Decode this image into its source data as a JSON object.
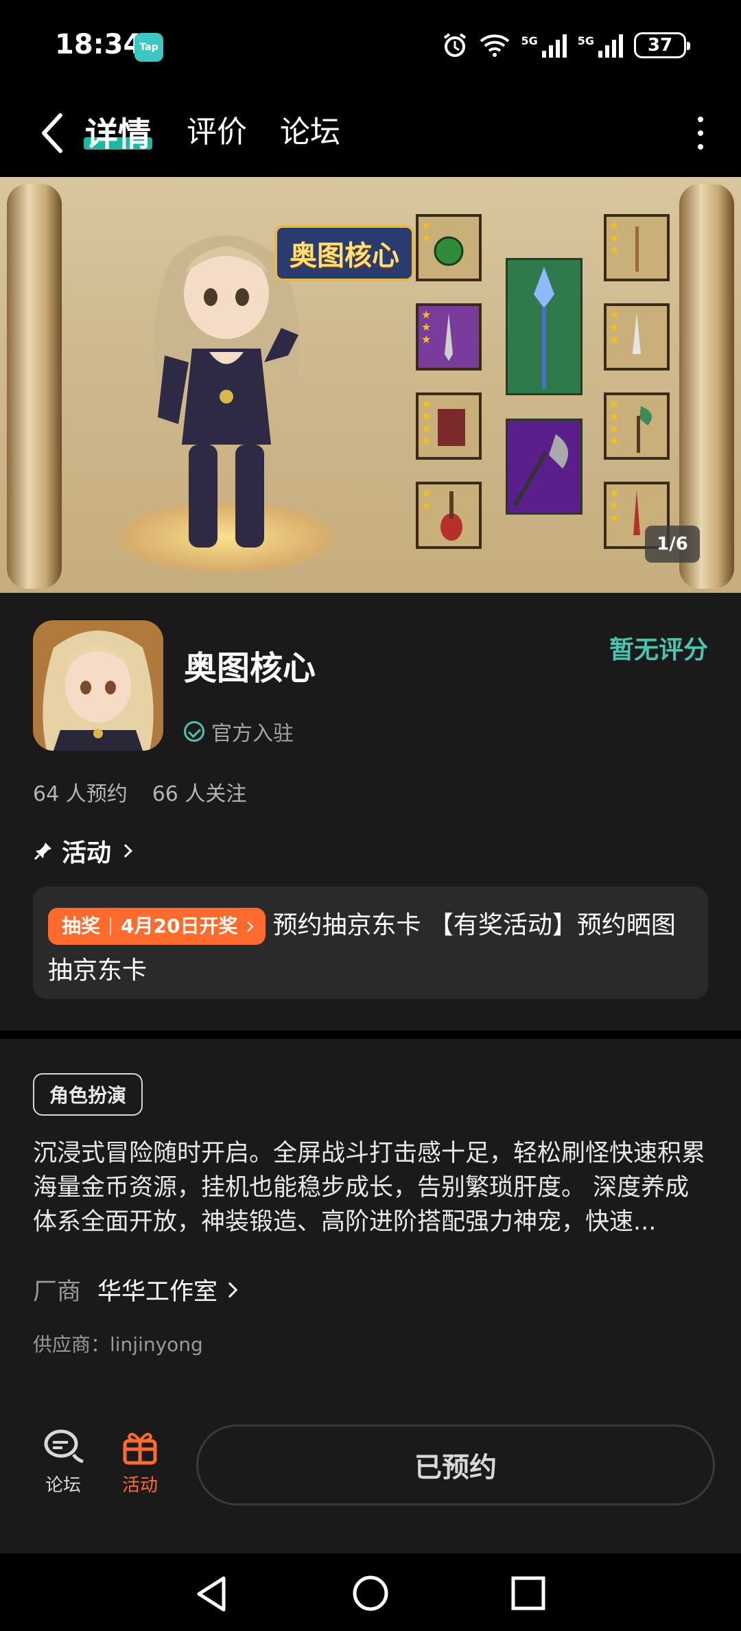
{
  "status_bar": {
    "time": "18:34",
    "tap_badge": "Tap",
    "net1": "5G",
    "net2": "5G",
    "battery": "37"
  },
  "nav": {
    "tab_details": "详情",
    "tab_reviews": "评价",
    "tab_forum": "论坛"
  },
  "banner": {
    "logo_text": "奥图核心",
    "page_indicator": "1/6"
  },
  "app": {
    "title": "奥图核心",
    "rating_status": "暂无评分",
    "official_label": "官方入驻",
    "reservations": "64 人预约",
    "followers": "66 人关注"
  },
  "activity": {
    "header": "活动",
    "tag_type": "抽奖",
    "tag_date": "4月20日开奖",
    "text_line1": "预约抽京东卡 【有奖活动】预约晒图",
    "text_line2": "抽京东卡"
  },
  "details": {
    "genre": "角色扮演",
    "description": "沉浸式冒险随时开启。全屏战斗打击感十足，轻松刷怪快速积累海量金币资源，挂机也能稳步成长，告别繁琐肝度。 深度养成体系全面开放，神装锻造、高阶进阶搭配强力神宠，快速...",
    "vendor_label": "厂商",
    "vendor_name": "华华工作室",
    "supplier": "供应商：linjinyong"
  },
  "bottom_bar": {
    "forum_label": "论坛",
    "activity_label": "活动",
    "reserved_label": "已预约"
  },
  "colors": {
    "accent_teal": "#4cc4b0",
    "accent_orange": "#ff6b2c",
    "background": "#1a1a1a"
  },
  "icons": [
    "back-icon",
    "more-icon",
    "check-circle-icon",
    "pin-icon",
    "chat-icon",
    "gift-icon",
    "wifi-icon",
    "alarm-icon",
    "signal-icon",
    "battery-icon"
  ]
}
